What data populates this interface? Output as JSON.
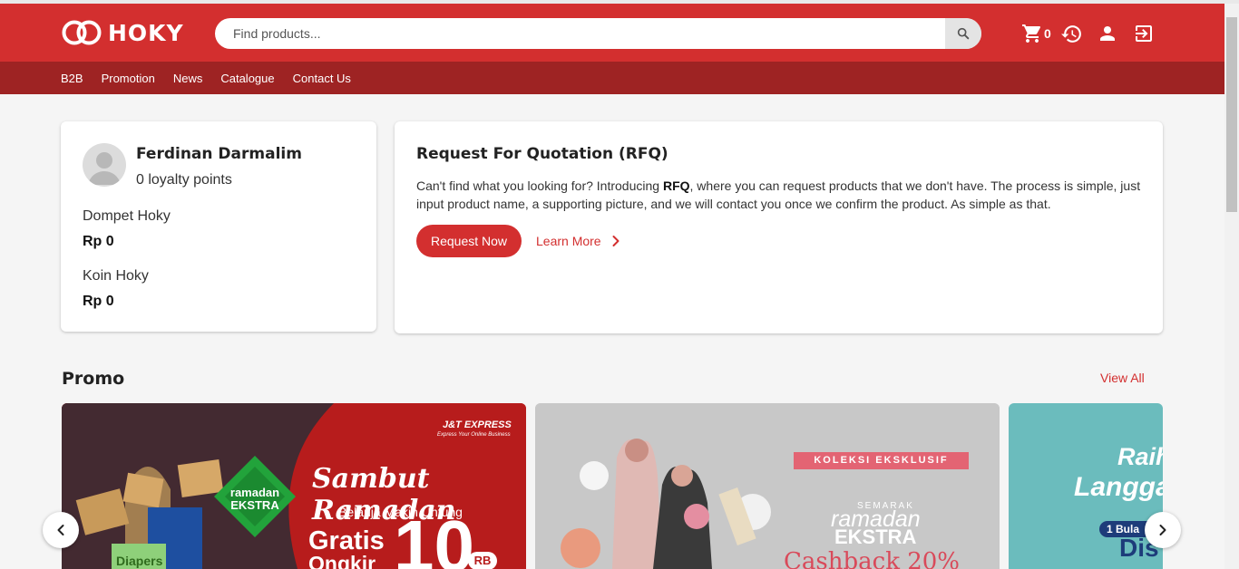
{
  "brand": {
    "name": "HOKY",
    "primary_color": "#d32f2f",
    "nav_color": "#9e2323"
  },
  "search": {
    "placeholder": "Find products..."
  },
  "header": {
    "cart_count": "0",
    "icons": [
      "search-icon",
      "cart-icon",
      "history-icon",
      "account-icon",
      "logout-icon"
    ]
  },
  "nav": {
    "items": [
      "B2B",
      "Promotion",
      "News",
      "Catalogue",
      "Contact Us"
    ]
  },
  "profile": {
    "name": "Ferdinan Darmalim",
    "points": "0 loyalty points",
    "wallet_label": "Dompet Hoky",
    "wallet_value": "Rp 0",
    "coin_label": "Koin Hoky",
    "coin_value": "Rp 0"
  },
  "rfq": {
    "title": "Request For Quotation (RFQ)",
    "desc_before": "Can't find what you looking for? Introducing ",
    "desc_bold": "RFQ",
    "desc_after": ", where you can request products that we don't have. The process is simple, just input product name, a supporting picture, and we will contact you once we confirm the product. As simple as that.",
    "request_button": "Request Now",
    "learn_more": "Learn More"
  },
  "promo": {
    "title": "Promo",
    "view_all": "View All",
    "banners": [
      {
        "brand": "J&T EXPRESS",
        "brand_sub": "Express Your Online Business",
        "badge": "ramadan EKSTRA",
        "headline": "Sambut Ramadan",
        "sub": "Belanja Makin Untung",
        "offer_line1": "Gratis",
        "offer_line2": "Ongkir",
        "offer_value": "10",
        "offer_unit": "RB",
        "product": "Diapers"
      },
      {
        "tag": "KOLEKSI EKSKLUSIF",
        "line1": "SEMARAK",
        "line2": "ramadan",
        "line3": "EKSTRA",
        "offer": "Cashback 20%"
      },
      {
        "line1": "Raih",
        "line2": "Langga",
        "pill": "1 Bula",
        "offer": "Dis"
      }
    ]
  }
}
